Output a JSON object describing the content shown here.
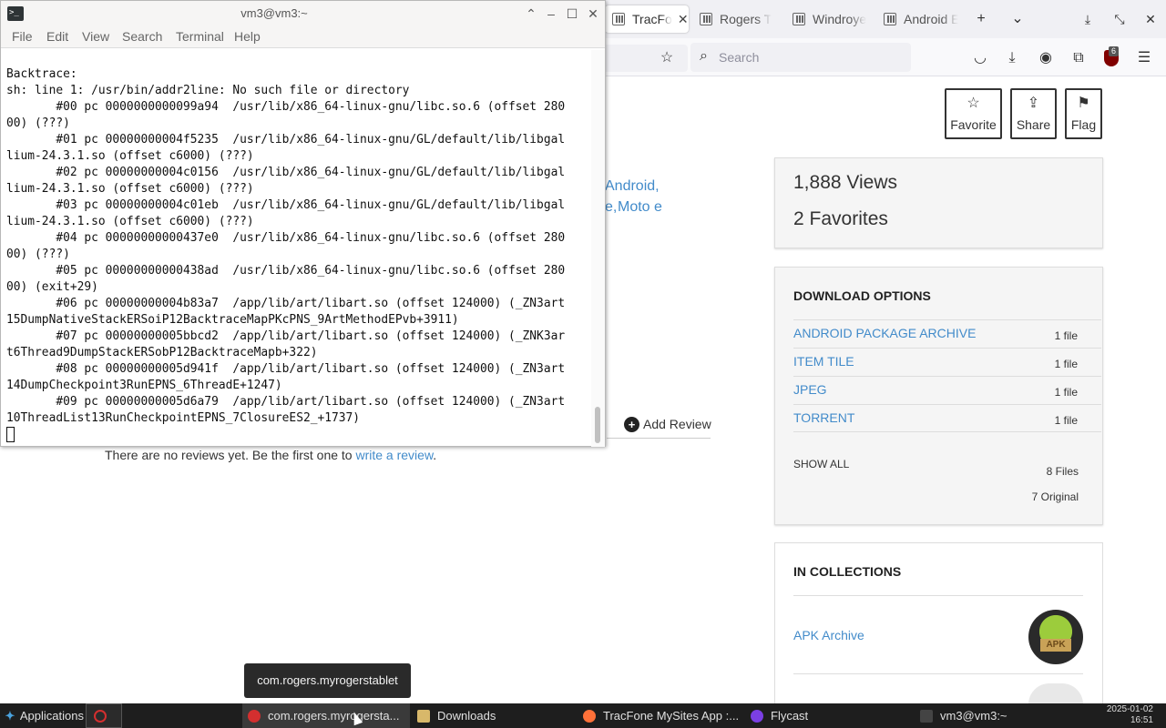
{
  "browser": {
    "tabs": [
      {
        "label": "TracFo",
        "active": true
      },
      {
        "label": "Rogers T",
        "active": false
      },
      {
        "label": "Windroye",
        "active": false
      },
      {
        "label": "Android E",
        "active": false
      }
    ],
    "new_tab_glyph": "+",
    "tab_list_glyph": "⌄",
    "search_placeholder": "Search",
    "page": {
      "actions": [
        {
          "label": "Favorite",
          "icon": "star-icon",
          "glyph": "☆"
        },
        {
          "label": "Share",
          "icon": "share-icon",
          "glyph": "⇪"
        },
        {
          "label": "Flag",
          "icon": "flag-icon",
          "glyph": "⚑"
        }
      ],
      "topic_links": {
        "android": "Android,",
        "moto_prefix": "e,",
        "moto": "Moto e"
      },
      "stats": {
        "views": "1,888 Views",
        "favorites": "2 Favorites"
      },
      "download_options": {
        "title": "DOWNLOAD OPTIONS",
        "items": [
          {
            "name": "ANDROID PACKAGE ARCHIVE",
            "count": "1 file"
          },
          {
            "name": "ITEM TILE",
            "count": "1 file"
          },
          {
            "name": "JPEG",
            "count": "1 file"
          },
          {
            "name": "TORRENT",
            "count": "1 file"
          }
        ],
        "show_all": "SHOW ALL",
        "total_files": "8 Files",
        "original": "7 Original"
      },
      "collections": {
        "title": "IN COLLECTIONS",
        "items": [
          {
            "name": "APK Archive",
            "badge": "APK"
          }
        ]
      },
      "reviews": {
        "add_label": "Add Review",
        "empty_text": "There are no reviews yet. Be the first one to ",
        "empty_link": "write a review",
        "empty_suffix": "."
      }
    }
  },
  "terminal": {
    "title": "vm3@vm3:~",
    "menu": [
      "File",
      "Edit",
      "View",
      "Search",
      "Terminal",
      "Help"
    ],
    "lines": [
      "Backtrace:",
      "sh: line 1: /usr/bin/addr2line: No such file or directory",
      "       #00 pc 0000000000099a94  /usr/lib/x86_64-linux-gnu/libc.so.6 (offset 280",
      "00) (???)",
      "       #01 pc 00000000004f5235  /usr/lib/x86_64-linux-gnu/GL/default/lib/libgal",
      "lium-24.3.1.so (offset c6000) (???)",
      "       #02 pc 00000000004c0156  /usr/lib/x86_64-linux-gnu/GL/default/lib/libgal",
      "lium-24.3.1.so (offset c6000) (???)",
      "       #03 pc 00000000004c01eb  /usr/lib/x86_64-linux-gnu/GL/default/lib/libgal",
      "lium-24.3.1.so (offset c6000) (???)",
      "       #04 pc 00000000000437e0  /usr/lib/x86_64-linux-gnu/libc.so.6 (offset 280",
      "00) (???)",
      "       #05 pc 00000000000438ad  /usr/lib/x86_64-linux-gnu/libc.so.6 (offset 280",
      "00) (exit+29)",
      "       #06 pc 00000000004b83a7  /app/lib/art/libart.so (offset 124000) (_ZN3art",
      "15DumpNativeStackERSoiP12BacktraceMapPKcPNS_9ArtMethodEPvb+3911)",
      "       #07 pc 00000000005bbcd2  /app/lib/art/libart.so (offset 124000) (_ZNK3ar",
      "t6Thread9DumpStackERSobP12BacktraceMapb+322)",
      "       #08 pc 00000000005d941f  /app/lib/art/libart.so (offset 124000) (_ZN3art",
      "14DumpCheckpoint3RunEPNS_6ThreadE+1247)",
      "       #09 pc 00000000005d6a79  /app/lib/art/libart.so (offset 124000) (_ZN3art",
      "10ThreadList13RunCheckpointEPNS_7ClosureES2_+1737)"
    ]
  },
  "tooltip": "com.rogers.myrogerstablet",
  "taskbar": {
    "applications": "Applications",
    "items": [
      {
        "label": "com.rogers.myrogersta...",
        "icon": "app-icon",
        "color": "#d32f2f",
        "active": true
      },
      {
        "label": "Downloads",
        "icon": "folder-icon",
        "color": "#d8b86a",
        "active": false
      },
      {
        "label": "TracFone MySites App :...",
        "icon": "firefox-icon",
        "color": "#ff7139",
        "active": false
      },
      {
        "label": "Flycast",
        "icon": "flycast-icon",
        "color": "#7b3fe4",
        "active": false
      },
      {
        "label": "vm3@vm3:~",
        "icon": "terminal-icon",
        "color": "#444444",
        "active": false
      }
    ],
    "date": "2025-01-02",
    "time": "16:51"
  }
}
